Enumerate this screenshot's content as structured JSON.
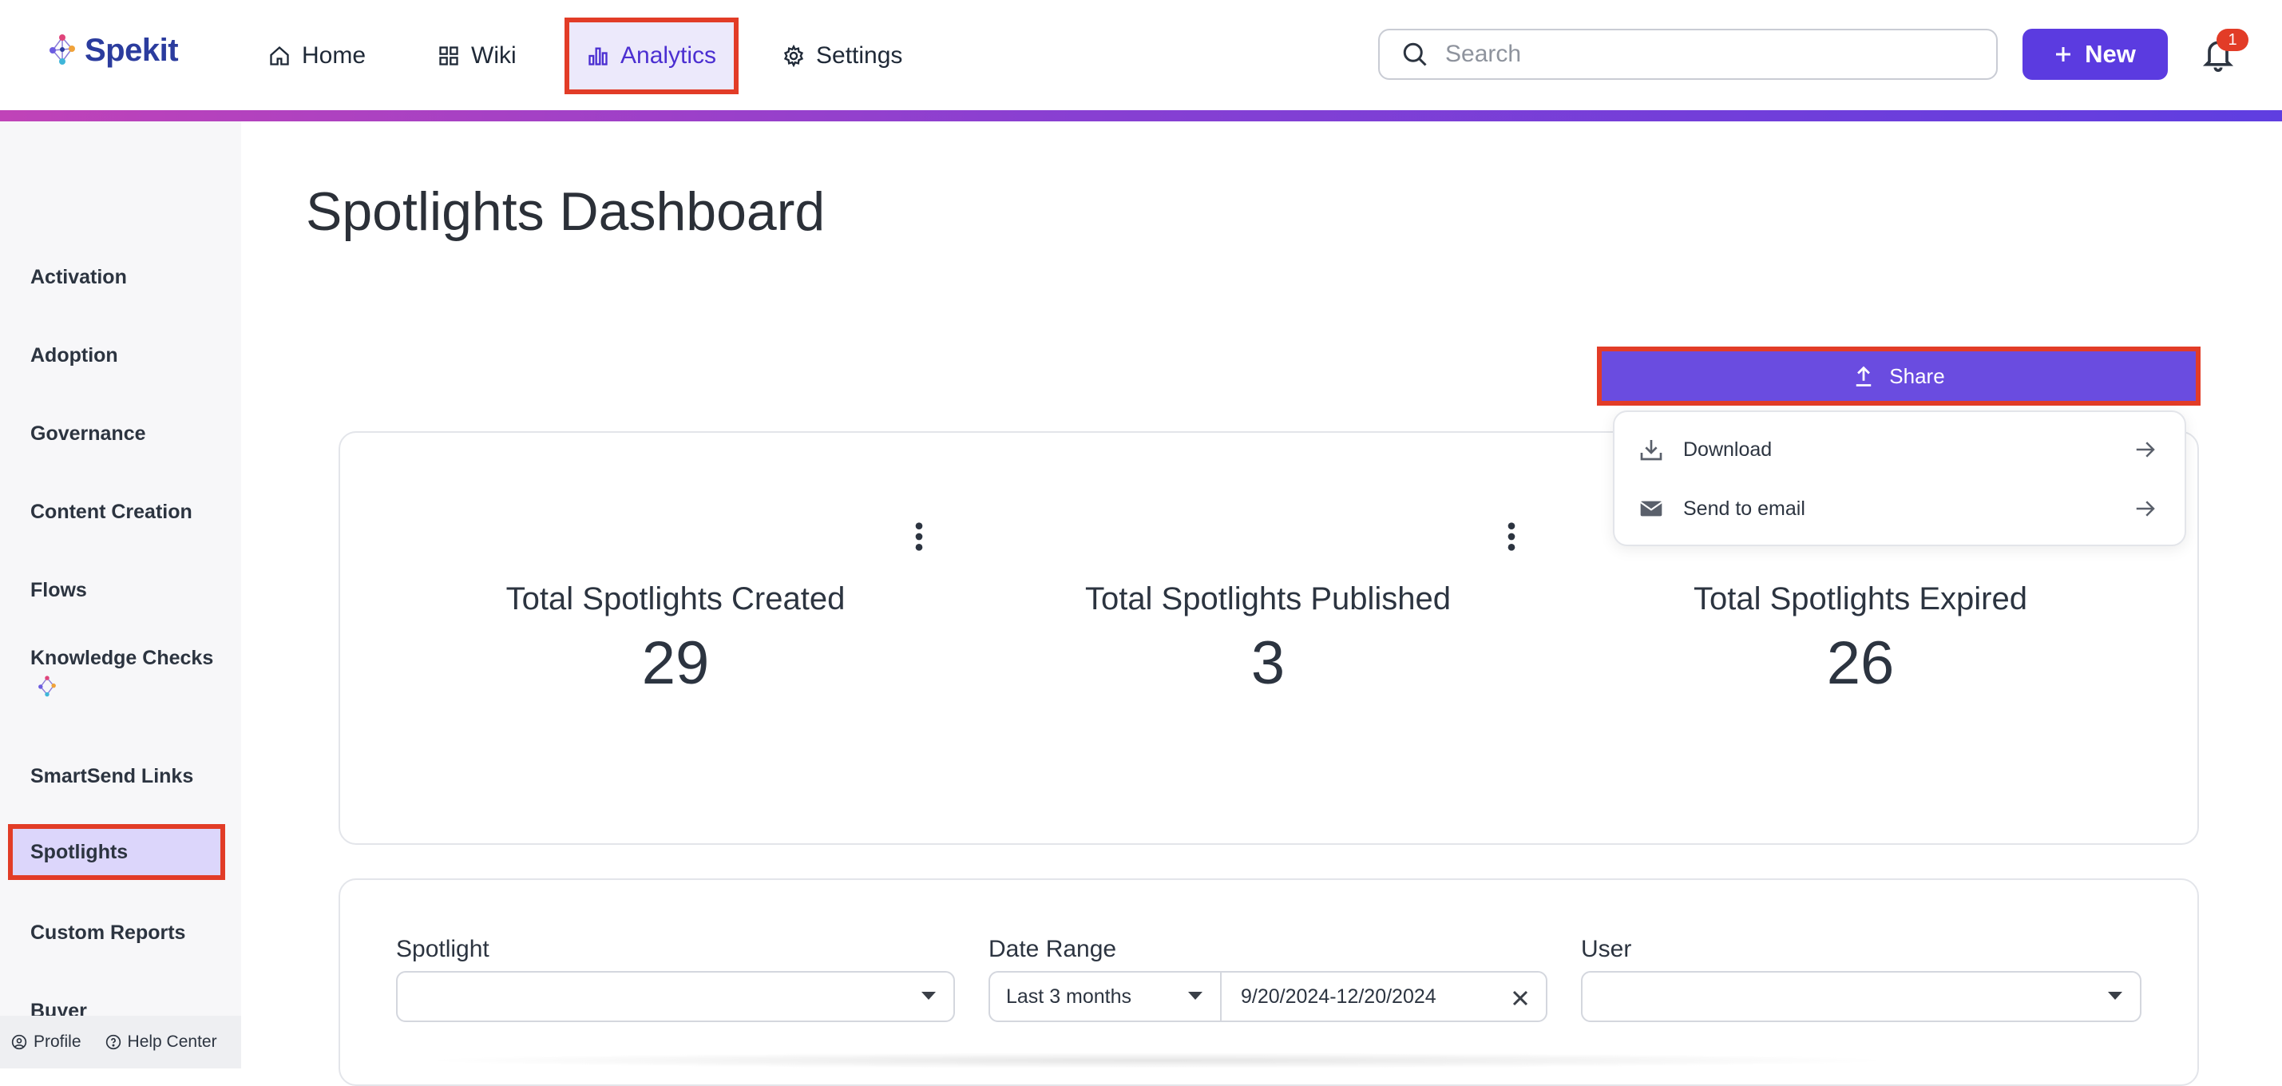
{
  "app": {
    "logo_text": "Spekit"
  },
  "nav": {
    "items": [
      {
        "label": "Home",
        "icon": "home-icon"
      },
      {
        "label": "Wiki",
        "icon": "grid-icon"
      },
      {
        "label": "Analytics",
        "icon": "bar-chart-icon",
        "active": true
      },
      {
        "label": "Settings",
        "icon": "gear-icon"
      }
    ]
  },
  "search": {
    "placeholder": "Search",
    "value": ""
  },
  "new_button": {
    "label": "New"
  },
  "notifications": {
    "count": "1"
  },
  "sidebar": {
    "items": [
      {
        "label": "Activation"
      },
      {
        "label": "Adoption"
      },
      {
        "label": "Governance"
      },
      {
        "label": "Content Creation"
      },
      {
        "label": "Flows"
      },
      {
        "label": "Knowledge Checks"
      },
      {
        "label": "SmartSend Links"
      },
      {
        "label": "Spotlights",
        "active": true
      },
      {
        "label": "Custom Reports"
      },
      {
        "label": "Buyer"
      }
    ],
    "footer": {
      "profile": "Profile",
      "help": "Help Center"
    }
  },
  "main": {
    "title": "Spotlights Dashboard",
    "share_label": "Share",
    "share_menu": [
      {
        "label": "Download",
        "icon": "download-icon"
      },
      {
        "label": "Send to email",
        "icon": "email-icon"
      }
    ],
    "stats": [
      {
        "label": "Total Spotlights Created",
        "value": "29"
      },
      {
        "label": "Total Spotlights Published",
        "value": "3"
      },
      {
        "label": "Total Spotlights Expired",
        "value": "26"
      }
    ],
    "filters": {
      "spotlight_label": "Spotlight",
      "spotlight_value": "",
      "date_range_label": "Date Range",
      "date_range_preset": "Last 3 months",
      "date_range_value": "9/20/2024-12/20/2024",
      "user_label": "User",
      "user_value": ""
    }
  },
  "colors": {
    "accent": "#5b3be0",
    "highlight": "#e23c27",
    "badge": "#e23c27"
  }
}
